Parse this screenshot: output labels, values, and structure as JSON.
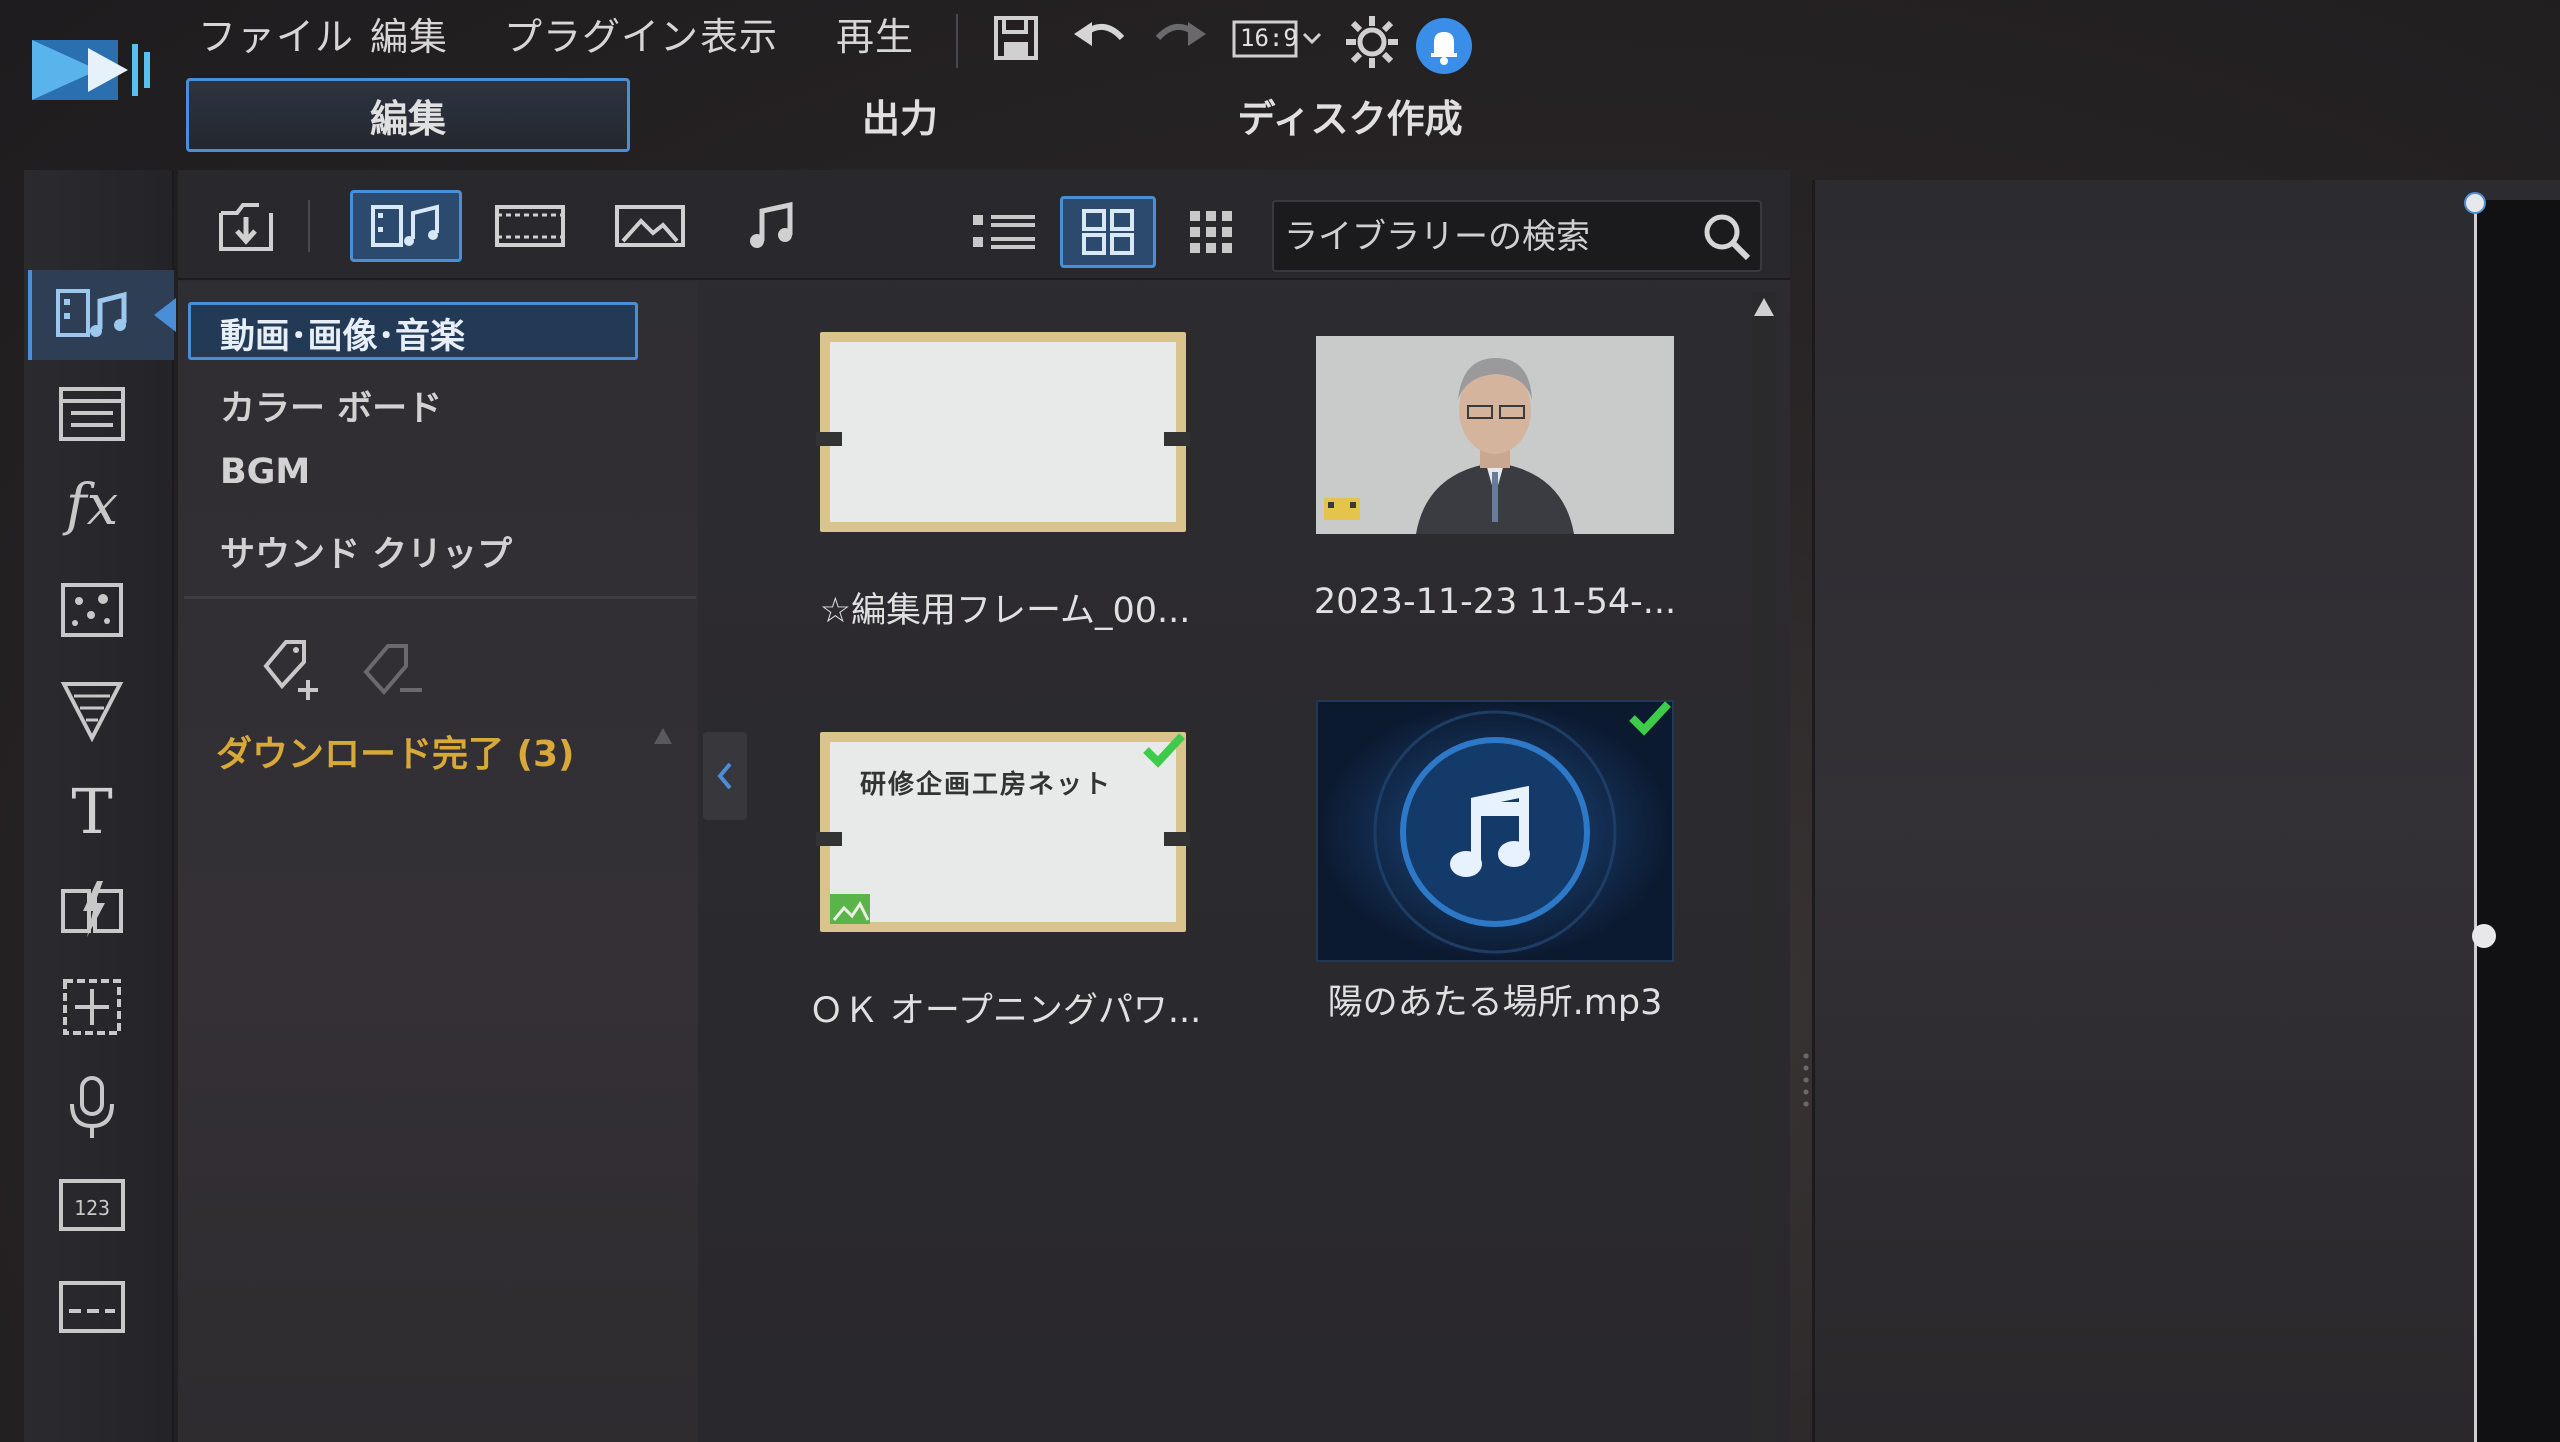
{
  "menu": {
    "file": "ファイル",
    "edit": "編集",
    "plugin": "プラグイン",
    "view": "表示",
    "play": "再生",
    "aspect_ratio": "16:9"
  },
  "modes": {
    "edit": "編集",
    "output": "出力",
    "disc": "ディスク作成"
  },
  "search": {
    "placeholder": "ライブラリーの検索"
  },
  "categories": [
    {
      "label": "動画･画像･音楽",
      "selected": true
    },
    {
      "label": "カラー ボード"
    },
    {
      "label": "BGM"
    },
    {
      "label": "サウンド クリップ"
    }
  ],
  "downloads": {
    "label": "ダウンロード完了 (3)"
  },
  "library_items": [
    {
      "caption": "☆編集用フレーム_00...",
      "type": "image"
    },
    {
      "caption": "2023-11-23 11-54-...",
      "type": "video"
    },
    {
      "caption": "ＯＫ オープニングパワ...",
      "type": "image",
      "thumb_text": "研修企画工房ネット",
      "checked": true
    },
    {
      "caption": "陽のあたる場所.mp3",
      "type": "audio",
      "checked": true
    }
  ],
  "colors": {
    "accent": "#4a8ed8",
    "download_label": "#d8a838",
    "check": "#3ecb4a",
    "notification": "#3a8ee8"
  }
}
